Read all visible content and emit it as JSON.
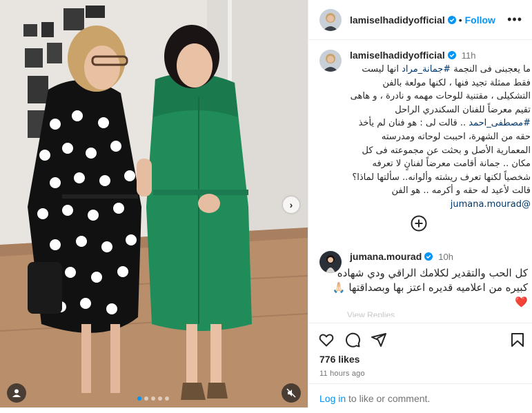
{
  "post": {
    "author": "lamiselhadidyofficial",
    "separator": "•",
    "follow_label": "Follow",
    "more_label": "•••",
    "caption_time": "11h",
    "caption_parts": [
      "ما يعجبنى فى النجمة ",
      "#جمانة_مراد",
      " انها ليست فقط ممثلة تجيد فنها ، لكنها مولعة بالفن التشكيلى ، مقتنية للوحات مهمه و نادرة ، و هاهى تقيم معرضاً للفنان السكندري الراحل ",
      "#مصطفى_احمد",
      " .. قالت لى : هو فنان لم يأخذ حقه من الشهرة، احببت لوحاته ومدرسته المعمارية الأصل و بحثت عن مجموعته فى كل مكان .. جمانة أقامت معرضاً لفنانٍ لا تعرفه شخصياً لكنها تعرف ريشته وألوانه.. سألتها لماذا؟ قالت لأعيد له حقه و أكرمه .. هو الفن ",
      "@jumana.mourad"
    ],
    "likes": "776 likes",
    "posted_ago": "11 hours ago"
  },
  "comment": {
    "author": "jumana.mourad",
    "time": "10h",
    "text": "كل الحب والتقدير لكلامك الراقي ودي شهاده كبيره من اعلاميه قديره اعتز بها وبصداقتها 🙏🏻❤️",
    "faded_reply": "View Replies"
  },
  "footer": {
    "login_link": "Log in",
    "login_rest": " to like or comment."
  },
  "media": {
    "carousel_count": 5,
    "carousel_active_index": 0
  },
  "colors": {
    "accent": "#0095f6",
    "verified": "#0095f6",
    "hashtag": "#00376b",
    "green_dress": "#1f8c5a"
  },
  "icons": [
    "chevron-right-icon",
    "user-tag-icon",
    "mute-icon",
    "heart-icon",
    "comment-icon",
    "share-icon",
    "bookmark-icon",
    "add-circle-icon",
    "verified-icon"
  ]
}
